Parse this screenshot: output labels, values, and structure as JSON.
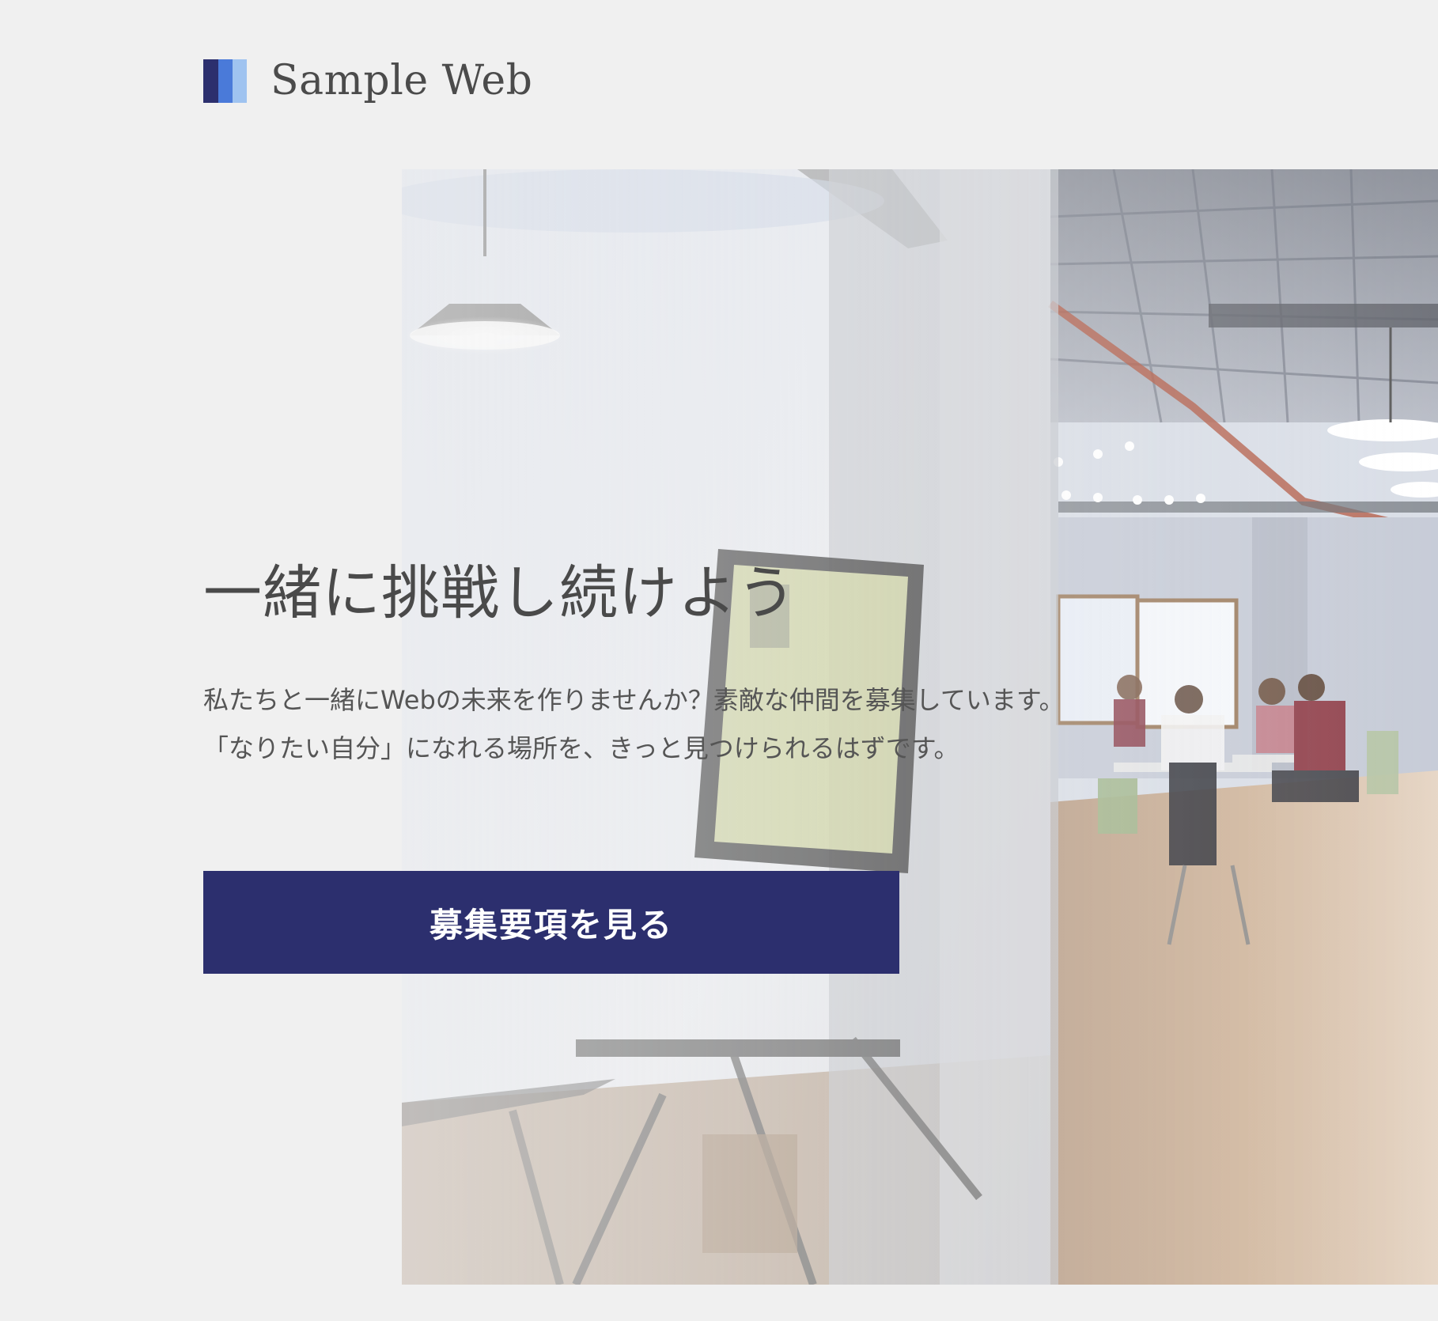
{
  "header": {
    "site_name": "Sample Web",
    "logo_colors": [
      "#2c2f6e",
      "#4a7ad9",
      "#9fc3f0"
    ]
  },
  "hero": {
    "title": "一緒に挑戦し続けよう",
    "description": "私たちと一緒にWebの未来を作りませんか？素敵な仲間を募集しています。 「なりたい自分」になれる場所を、きっと見つけられるはずです。",
    "cta_label": "募集要項を見る",
    "image_alt": "office-photo"
  },
  "colors": {
    "background": "#f0f0f0",
    "accent": "#2c2f6e",
    "text": "#4a4a4a"
  }
}
